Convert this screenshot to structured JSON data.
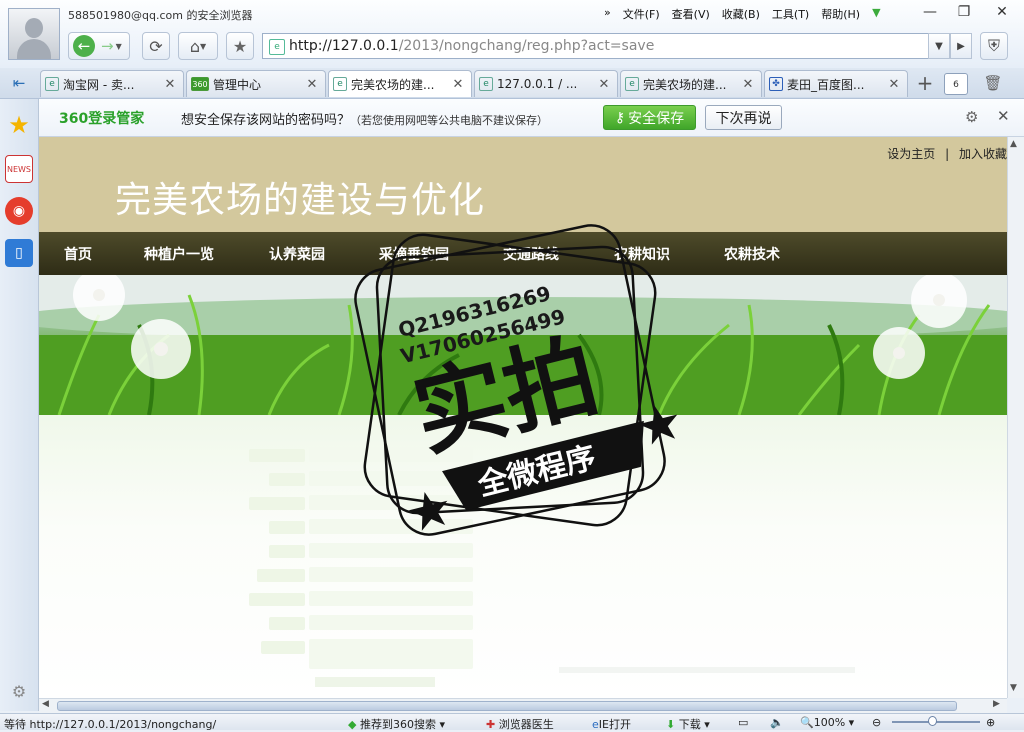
{
  "window": {
    "user_title": "588501980@qq.com 的安全浏览器",
    "menu": [
      "文件(F)",
      "查看(V)",
      "收藏(B)",
      "工具(T)",
      "帮助(H)"
    ]
  },
  "address": {
    "host": "http://127.0.0.1",
    "path": "/2013/nongchang/reg.php?act=save"
  },
  "tabs": [
    {
      "label": "淘宝网 - 卖...",
      "favicon": "e"
    },
    {
      "label": "管理中心",
      "favicon": "360"
    },
    {
      "label": "完美农场的建...",
      "favicon": "e"
    },
    {
      "label": "127.0.0.1 / ...",
      "favicon": "e"
    },
    {
      "label": "完美农场的建...",
      "favicon": "e"
    },
    {
      "label": "麦田_百度图...",
      "favicon": "paw"
    }
  ],
  "tab_count": "6",
  "password_bar": {
    "brand": "360登录管家",
    "message": "想安全保存该网站的密码吗？",
    "note": "（若您使用网吧等公共电脑不建议保存）",
    "save_label": "安全保存",
    "later_label": "下次再说"
  },
  "site": {
    "title": "完美农场的建设与优化",
    "set_home": "设为主页",
    "separator": "|",
    "add_favorite": "加入收藏",
    "nav": [
      "首页",
      "种植户一览",
      "认养菜园",
      "采摘垂钓园",
      "交通路线",
      "农耕知识",
      "农耕技术"
    ]
  },
  "watermark": {
    "line1": "Q2196316269",
    "line2": "V17060256499",
    "main": "实拍",
    "ribbon": "全微程序"
  },
  "status": {
    "loading": "等待 http://127.0.0.1/2013/nongchang/",
    "recommend": "推荐到360搜索",
    "doctor": "浏览器医生",
    "ie": "IE打开",
    "download": "下载",
    "zoom": "100%"
  },
  "colors": {
    "site_header": "#d3c89d",
    "site_nav": "#3a3820",
    "save_button": "#4caf30",
    "brand": "#2aa12a"
  }
}
